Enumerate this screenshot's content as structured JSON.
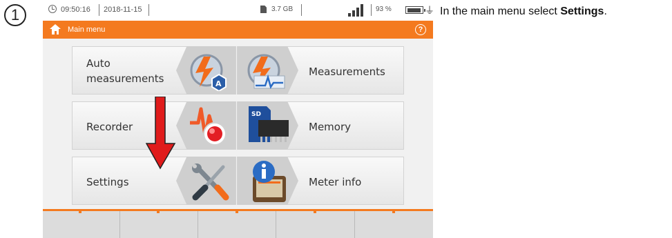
{
  "step_number": "1",
  "status_bar": {
    "time": "09:50:16",
    "date": "2018-11-15",
    "storage": "3.7 GB",
    "battery_percent": "93 %",
    "battery_level": 0.93,
    "signal_bars": 4
  },
  "title_bar": {
    "title": "Main menu",
    "help_label": "?"
  },
  "menu": {
    "auto_measurements": "Auto measurements",
    "measurements": "Measurements",
    "recorder": "Recorder",
    "memory": "Memory",
    "settings": "Settings",
    "meter_info": "Meter info"
  },
  "instruction": {
    "text": "In the main menu select",
    "bold": "Settings",
    "suffix": "."
  },
  "colors": {
    "accent": "#f47a1f",
    "arrow": "#e01b1b"
  },
  "icons": [
    "clock-icon",
    "sd-card-icon",
    "signal-icon",
    "battery-icon",
    "plug-icon",
    "home-icon",
    "help-icon",
    "auto-measurement-icon",
    "measurement-icon",
    "recorder-icon",
    "memory-icon",
    "settings-tools-icon",
    "meter-info-icon"
  ]
}
